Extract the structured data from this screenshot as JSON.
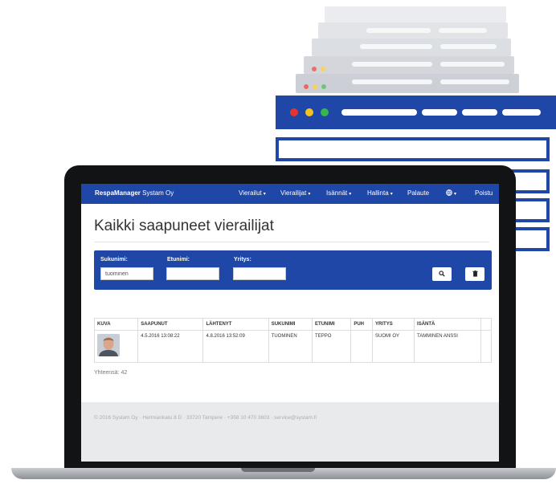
{
  "colors": {
    "brand_blue": "#1f47a7",
    "dot_red": "#e8332a",
    "dot_yellow": "#f6c21c",
    "dot_green": "#3ab54a"
  },
  "app": {
    "brand_bold": "RespaManager",
    "brand_rest": "Systam Oy"
  },
  "nav": [
    {
      "label": "Vierailut",
      "caret": true
    },
    {
      "label": "Vierailijat",
      "caret": true
    },
    {
      "label": "Isännät",
      "caret": true
    },
    {
      "label": "Hallinta",
      "caret": true
    },
    {
      "label": "Palaute",
      "caret": false
    },
    {
      "label": "",
      "icon": "globe-icon",
      "caret": true
    },
    {
      "label": "Poistu",
      "caret": false
    }
  ],
  "page": {
    "title": "Kaikki saapuneet vierailijat"
  },
  "search": {
    "surname_label": "Sukunimi:",
    "surname_value": "tuominen",
    "firstname_label": "Etunimi:",
    "firstname_value": "",
    "company_label": "Yritys:",
    "company_value": "",
    "search_icon": "search-icon",
    "clear_icon": "trash-icon"
  },
  "table": {
    "headers": [
      "KUVA",
      "SAAPUNUT",
      "LÄHTENYT",
      "SUKUNIMI",
      "ETUNIMI",
      "PUH",
      "YRITYS",
      "ISÄNTÄ",
      ""
    ],
    "rows": [
      {
        "photo": "visitor-photo",
        "arrived": "4.5.2016 13:08:22",
        "left": "4.8.2016 13:52:09",
        "surname": "TUOMINEN",
        "firstname": "TEPPO",
        "phone": "",
        "company": "SUOMI OY",
        "host": "TAMMINEN ANSSI",
        "extra": ""
      }
    ],
    "total_text": "Yhteensä: 42"
  },
  "footer": {
    "text": "© 2016 Systam Oy  ·  Hermiankatu 8 D  ·  33720 Tampere  ·  +358 10 470 3603  ·  service@systam.fi"
  }
}
